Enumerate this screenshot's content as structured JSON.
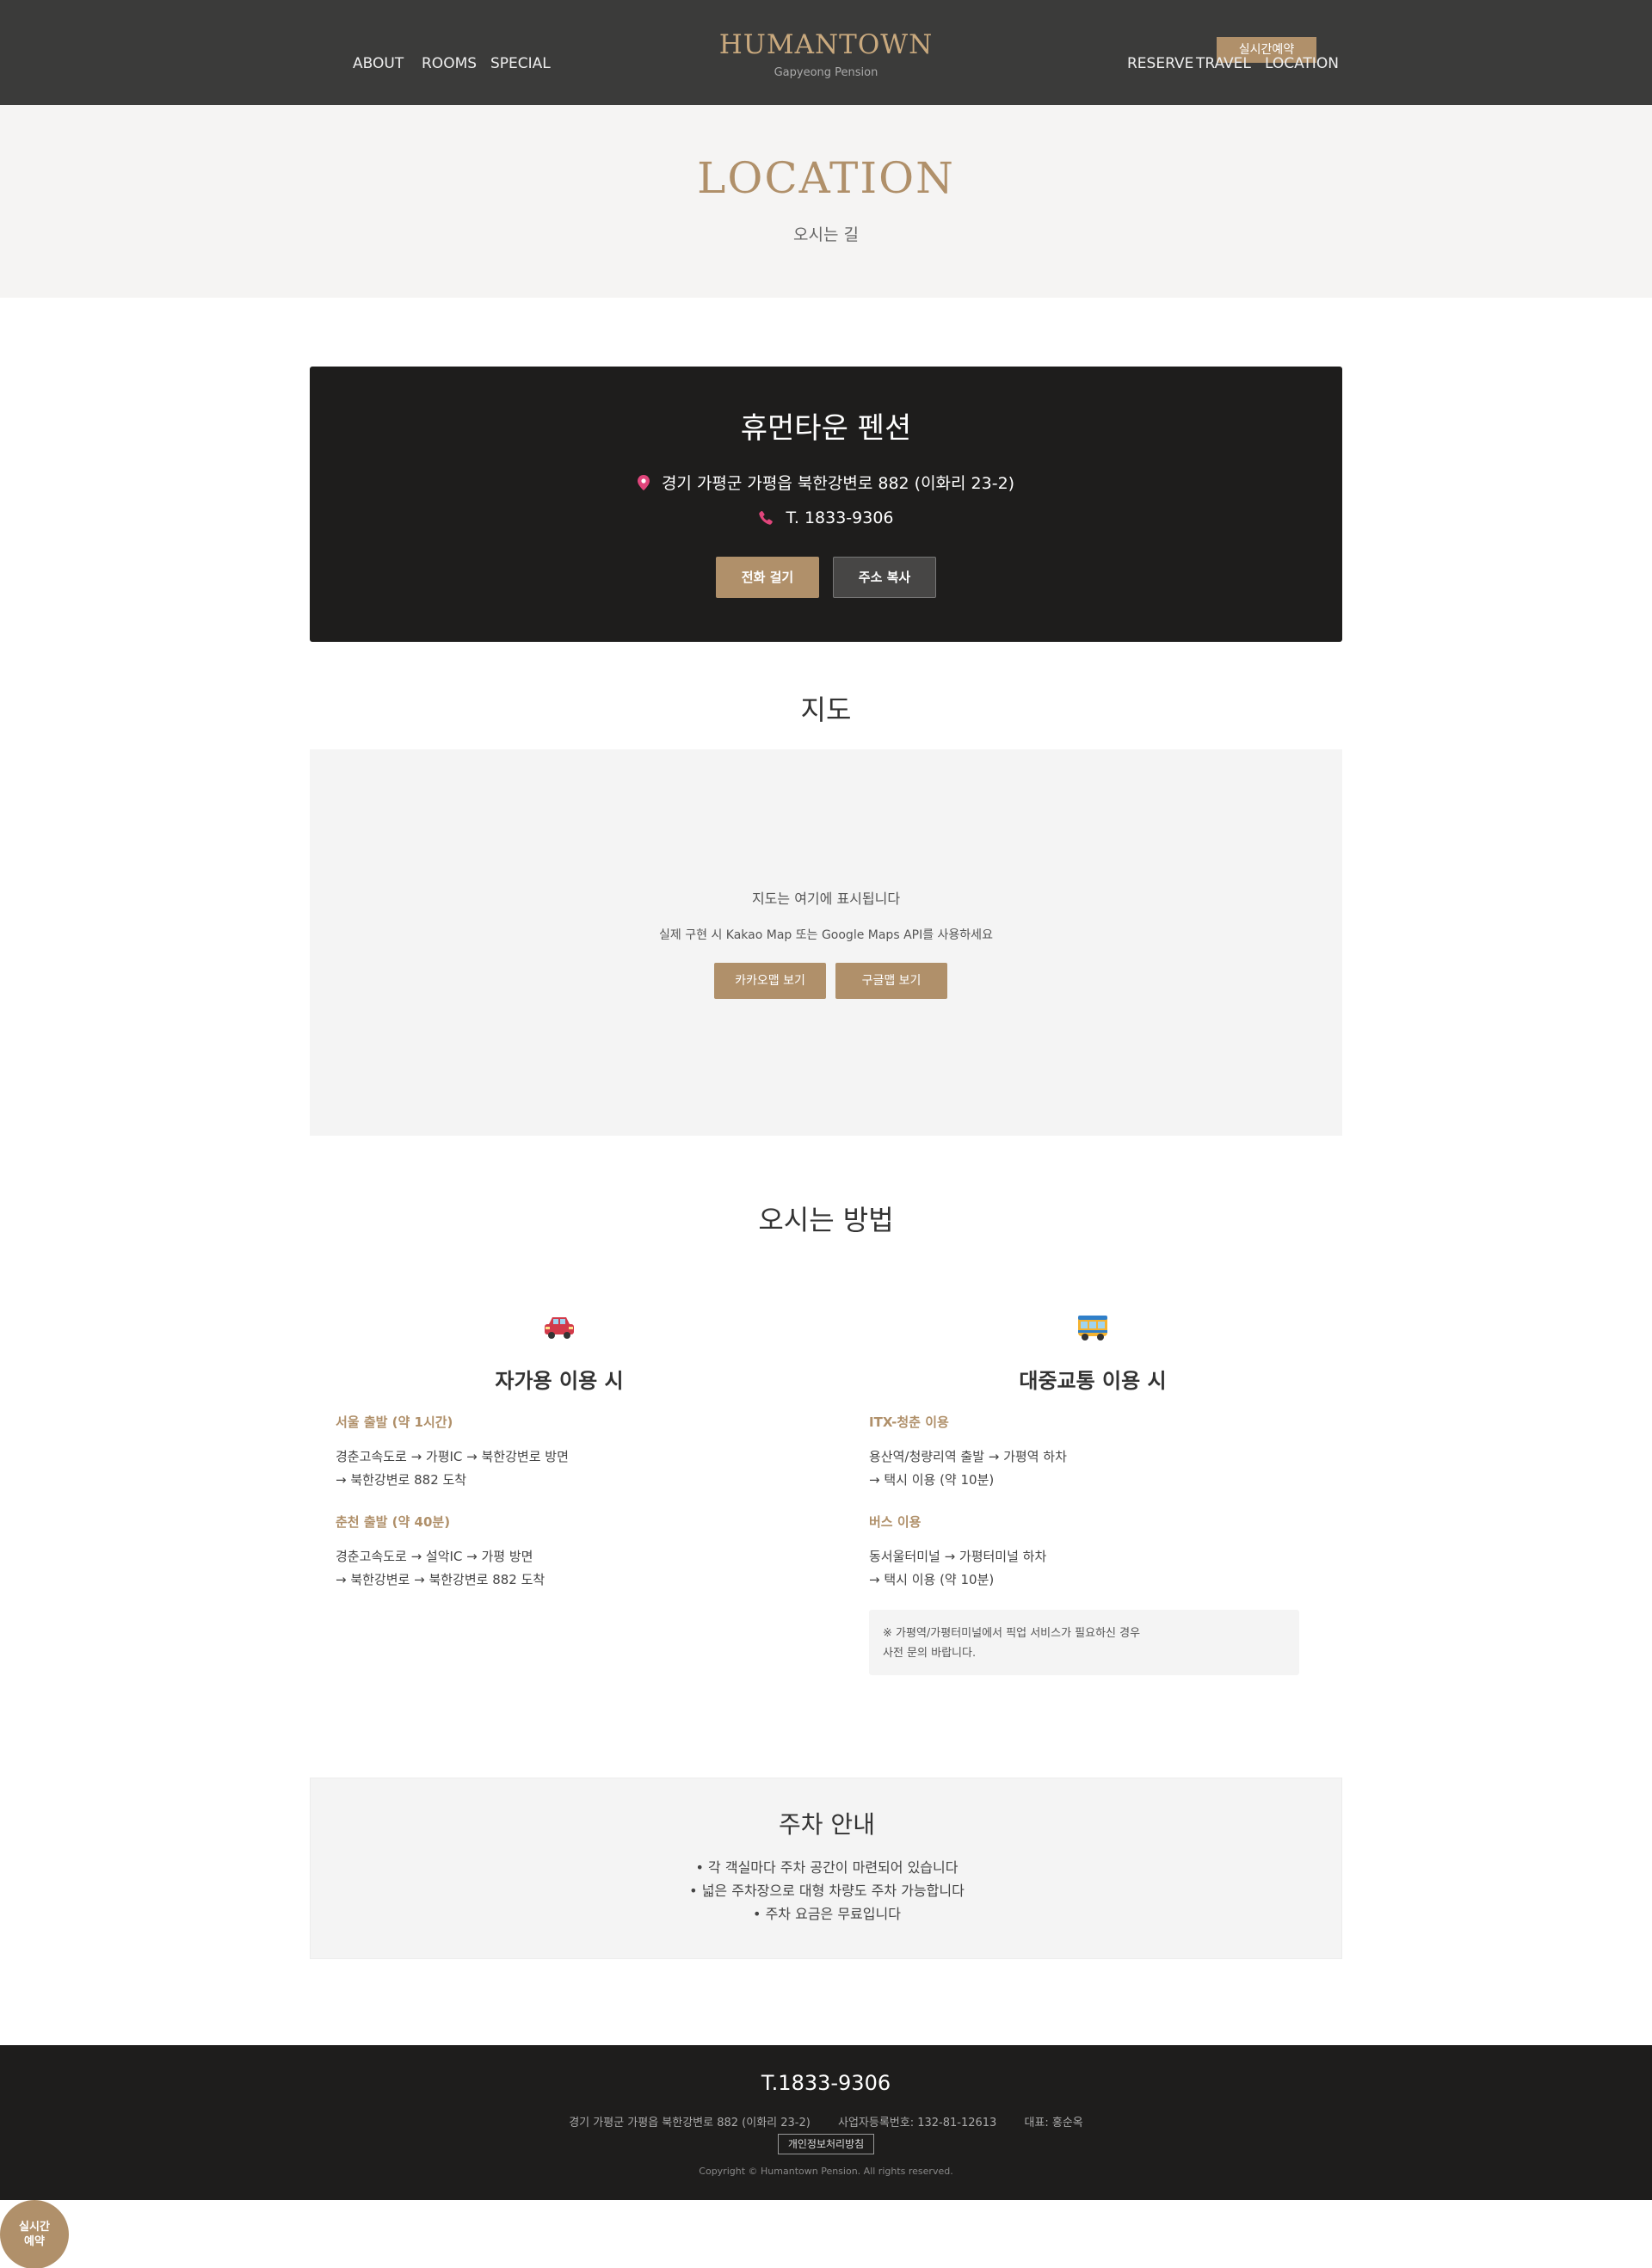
{
  "header": {
    "nav_left": [
      "ABOUT",
      "ROOMS",
      "SPECIAL"
    ],
    "logo": "HUMANTOWN",
    "logo_sub": "Gapyeong Pension",
    "nav_right": [
      "RESERVE",
      "TRAVEL",
      "LOCATION"
    ],
    "reserve_button": "실시간예약"
  },
  "hero": {
    "title": "LOCATION",
    "subtitle": "오시는 길"
  },
  "info": {
    "name": "휴먼타운 펜션",
    "address": "경기 가평군 가평읍 북한강변로 882 (이화리 23-2)",
    "phone": "T. 1833-9306",
    "call_button": "전화 걸기",
    "copy_button": "주소 복사",
    "address_icon": "map-pin-icon",
    "phone_icon": "phone-icon"
  },
  "map": {
    "title": "지도",
    "placeholder": "지도는 여기에 표시됩니다",
    "note": "실제 구현 시 Kakao Map 또는 Google Maps API를 사용하세요",
    "kakao_button": "카카오맵 보기",
    "google_button": "구글맵 보기"
  },
  "directions": {
    "title": "오시는 방법",
    "car": {
      "icon": "car-icon",
      "title": "자가용 이용 시",
      "routes": [
        {
          "head": "서울 출발 (약 1시간)",
          "line1": "경춘고속도로 → 가평IC → 북한강변로 방면",
          "line2": "→ 북한강변로 882 도착"
        },
        {
          "head": "춘천 출발 (약 40분)",
          "line1": "경춘고속도로 → 설악IC → 가평 방면",
          "line2": "→ 북한강변로 → 북한강변로 882 도착"
        }
      ]
    },
    "transit": {
      "icon": "bus-icon",
      "title": "대중교통 이용 시",
      "routes": [
        {
          "head": "ITX-청춘 이용",
          "line1": "용산역/청량리역 출발 → 가평역 하차",
          "line2": "→ 택시 이용 (약 10분)"
        },
        {
          "head": "버스 이용",
          "line1": "동서울터미널 → 가평터미널 하차",
          "line2": "→ 택시 이용 (약 10분)"
        }
      ],
      "notice_line1": "※ 가평역/가평터미널에서 픽업 서비스가 필요하신 경우",
      "notice_line2": "사전 문의 바랍니다."
    }
  },
  "parking": {
    "title": "주차 안내",
    "items": [
      "• 각 객실마다 주차 공간이 마련되어 있습니다",
      "• 넓은 주차장으로 대형 차량도 주차 가능합니다",
      "• 주차 요금은 무료입니다"
    ]
  },
  "footer": {
    "phone": "T.1833-9306",
    "address": "경기 가평군 가평읍 북한강변로 882 (이화리 23-2)",
    "business_no": "사업자등록번호: 132-81-12613",
    "ceo": "대표: 홍순옥",
    "privacy": "개인정보처리방침",
    "copyright": "Copyright © Humantown Pension. All rights reserved."
  },
  "floating": {
    "line1": "실시간",
    "line2": "예약"
  },
  "colors": {
    "header_bg": "#3b3b3a",
    "accent_gold": "#b0906a",
    "dark_box": "#1e1d1c",
    "light_bg": "#f4f4f4"
  }
}
